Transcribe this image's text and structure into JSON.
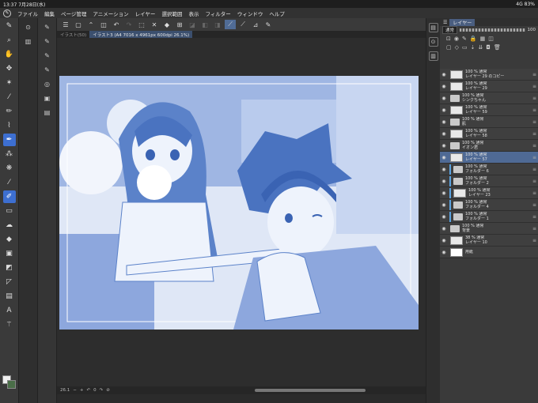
{
  "status": {
    "time": "13:37",
    "date": "7月28日(水)",
    "signal": "4G",
    "battery": "83%"
  },
  "menu": [
    "ファイル",
    "編集",
    "ページ管理",
    "アニメーション",
    "レイヤー",
    "選択範囲",
    "表示",
    "フィルター",
    "ウィンドウ",
    "ヘルプ"
  ],
  "tabs": [
    {
      "label": "イラスト(50)"
    },
    {
      "label": "イラスト3 (A4 7016 x 4961px 600dpi 26.1%)"
    }
  ],
  "layer_panel": {
    "tab_label": "レイヤー",
    "blend_mode": "通常",
    "opacity": "100",
    "layers": [
      {
        "line1": "100 % 通常",
        "line2": "レイヤー 29 のコピー",
        "kind": "layer",
        "selected": false
      },
      {
        "line1": "100 % 通常",
        "line2": "レイヤー 29",
        "kind": "layer",
        "selected": false
      },
      {
        "line1": "100 % 通常",
        "line2": "シンクちゃん",
        "kind": "folder",
        "selected": false
      },
      {
        "line1": "100 % 通常",
        "line2": "レイヤー 59",
        "kind": "layer",
        "selected": false
      },
      {
        "line1": "100 % 通常",
        "line2": "肌",
        "kind": "folder",
        "selected": false
      },
      {
        "line1": "100 % 通常",
        "line2": "レイヤー 58",
        "kind": "layer",
        "selected": false
      },
      {
        "line1": "100 % 通常",
        "line2": "イオン君",
        "kind": "folder",
        "selected": false
      },
      {
        "line1": "100 % 通常",
        "line2": "レイヤー 57",
        "kind": "layer",
        "selected": true
      },
      {
        "line1": "100 % 通常",
        "line2": "フォルダー 6",
        "kind": "folder",
        "selected": false
      },
      {
        "line1": "100 % 通常",
        "line2": "フォルダー 2",
        "kind": "folder",
        "selected": false
      },
      {
        "line1": "100 % 通常",
        "line2": "レイヤー 23",
        "kind": "layer",
        "selected": false
      },
      {
        "line1": "100 % 通常",
        "line2": "フォルダー 4",
        "kind": "folder",
        "selected": false
      },
      {
        "line1": "100 % 通常",
        "line2": "フォルダー 1",
        "kind": "folder",
        "selected": false
      },
      {
        "line1": "100 % 通常",
        "line2": "背景",
        "kind": "folder",
        "selected": false
      },
      {
        "line1": "38 % 通常",
        "line2": "レイヤー 10",
        "kind": "layer",
        "selected": false
      },
      {
        "line1": "",
        "line2": "用紙",
        "kind": "paper",
        "selected": false
      }
    ]
  },
  "bottom": {
    "zoom": "26.1",
    "angle": "0"
  },
  "colors": {
    "accent": "#3d6fd1",
    "art_tint": "#5b82c9",
    "selected_layer": "#4f6a95"
  }
}
